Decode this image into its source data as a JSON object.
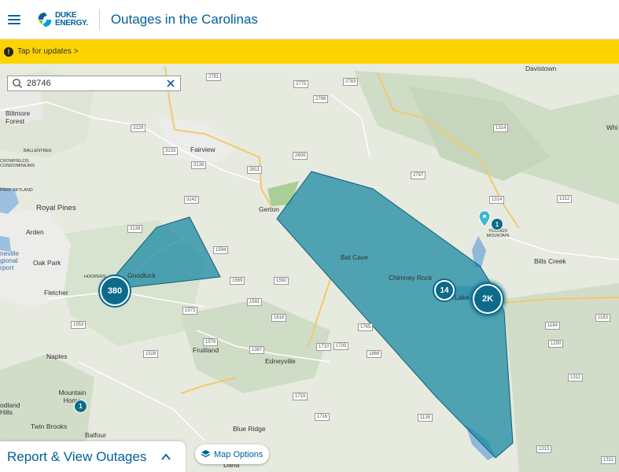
{
  "header": {
    "menu_icon": "hamburger-menu-icon",
    "logo_text_line1": "DUKE",
    "logo_text_line2": "ENERGY.",
    "title": "Outages in the Carolinas"
  },
  "banner": {
    "icon": "alert-circle-icon",
    "icon_glyph": "!",
    "text": "Tap for updates >"
  },
  "search": {
    "value": "28746",
    "icon": "search-icon",
    "clear_icon": "close-icon"
  },
  "clusters": [
    {
      "id": "cluster-380",
      "label": "380"
    },
    {
      "id": "cluster-14",
      "label": "14"
    },
    {
      "id": "cluster-2k",
      "label": "2K"
    },
    {
      "id": "cluster-1-yodmountain",
      "label": "1"
    },
    {
      "id": "cluster-1-mountainhome",
      "label": "1"
    }
  ],
  "places": [
    "Davistown",
    "Biltmore Forest",
    "Fairview",
    "Gerton",
    "Royal Pines",
    "Arden",
    "Oak Park",
    "Fletcher",
    "Goodluck",
    "Bat Cave",
    "Chimney Rock",
    "Lake",
    "Bills Creek",
    "Fruitland",
    "Edneyville",
    "Naples",
    "Mountain Home",
    "Twin Brooks",
    "Balfour",
    "Blue Ridge",
    "Whi",
    "Hills",
    "YOUNGS MOUNTAIN",
    "BALLENTREE",
    "CROWFIELDS CONDOMINIUMS",
    "PARK SKYLAND",
    "HOOPERS",
    "odland",
    "neville gional rport",
    "Dana"
  ],
  "bottom": {
    "report_label": "Report & View Outages",
    "report_chevron": "chevron-up-icon",
    "map_options_label": "Map Options",
    "map_options_icon": "layers-icon"
  },
  "colors": {
    "brand": "#00609c",
    "banner": "#fdd400",
    "outage_fill": "#1b8aa3",
    "outage_stroke": "#0e5f78",
    "cluster": "#0e6a8a"
  }
}
